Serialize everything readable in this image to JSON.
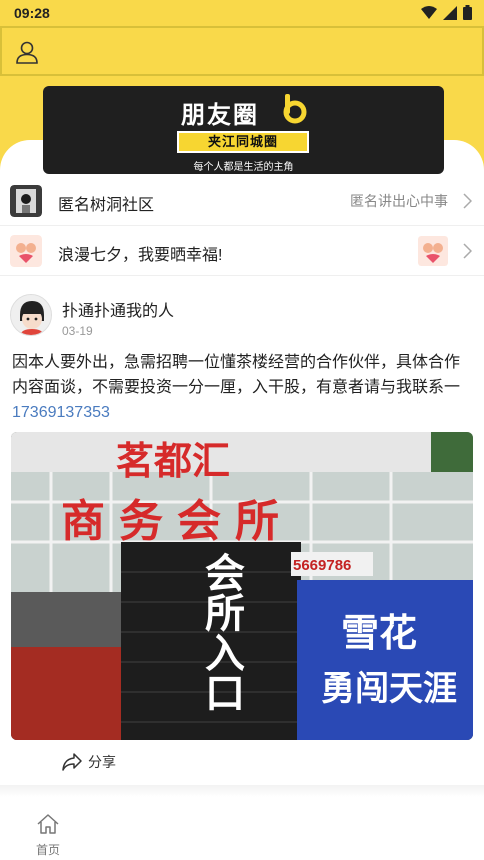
{
  "status": {
    "time": "09:28"
  },
  "banner": {
    "title": "朋友圈",
    "subtitle": "夹江同城圈",
    "slogan": "每个人都是生活的主角"
  },
  "rows": [
    {
      "label": "匿名树洞社区",
      "right_text": "匿名讲出心中事",
      "icon": "hole-icon"
    },
    {
      "label": "浪漫七夕，我要晒幸福!",
      "icon": "couple-icon"
    }
  ],
  "post": {
    "author": "扑通扑通我的人",
    "date": "03-19",
    "body": "因本人要外出，急需招聘一位懂茶楼经营的合作伙伴，具体合作内容面谈，不需要投资一分一厘，入干股，有意者请与我联系一",
    "phone": "17369137353",
    "photo": {
      "sign_top": "茗都汇",
      "sign_main": "商务会所",
      "phone_fragment": "5669786",
      "door_sign": "会所入口",
      "banner_brand": "雪花",
      "banner_slogan": "勇闯天涯"
    },
    "share_label": "分享"
  },
  "tabbar": {
    "home_label": "首页"
  }
}
